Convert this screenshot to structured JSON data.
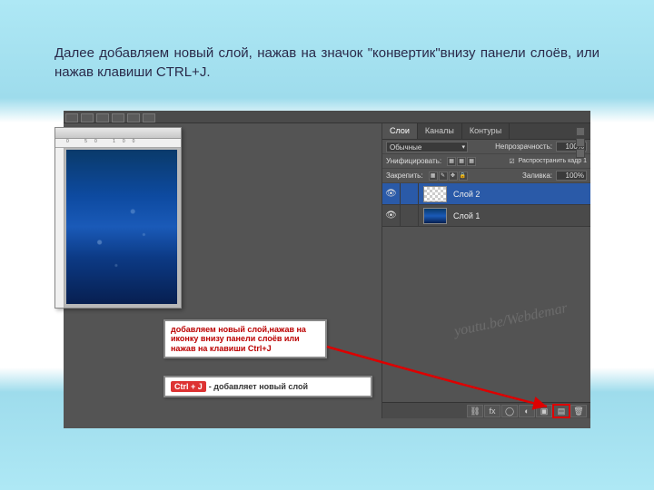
{
  "slide": {
    "text": "Далее добавляем новый слой, нажав на значок \"конвертик\"внизу панели слоёв, или нажав клавиши CTRL+J."
  },
  "ruler": {
    "marks": "0   50  100"
  },
  "panel": {
    "tabs": {
      "layers": "Слои",
      "channels": "Каналы",
      "paths": "Контуры"
    },
    "mode": "Обычные",
    "opacity_label": "Непрозрачность:",
    "opacity_value": "100%",
    "unified_label": "Унифицировать:",
    "propagate_label": "Распространить кадр 1",
    "lock_label": "Закрепить:",
    "fill_label": "Заливка:",
    "fill_value": "100%"
  },
  "layers": [
    {
      "name": "Слой 2",
      "selected": true,
      "thumb": "checker"
    },
    {
      "name": "Слой 1",
      "selected": false,
      "thumb": "img"
    }
  ],
  "footer_icons": {
    "link": "⛓",
    "fx": "fx",
    "mask": "◯",
    "adjust": "◐",
    "folder": "▣",
    "new": "▤",
    "trash": "🗑"
  },
  "callouts": {
    "c1_l1": "добавляем новый слой,нажав на",
    "c1_l2": "иконку внизу панели слоёв или",
    "c1_l3": "нажав на клавиши Ctrl+J",
    "c2_kbd": "Ctrl + J",
    "c2_rest": "- добавляет новый слой"
  },
  "watermark": "youtu.be/Webdemar"
}
